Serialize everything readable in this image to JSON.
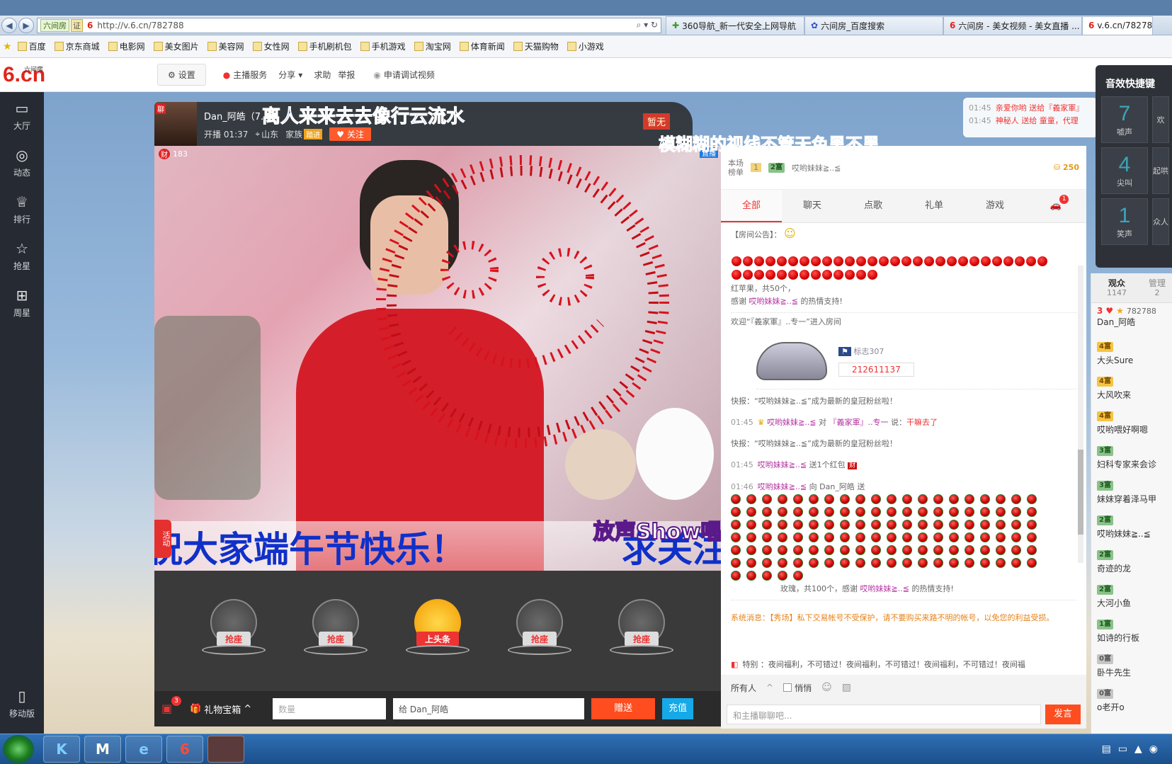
{
  "browser": {
    "url": "http://v.6.cn/782788",
    "addr_tag": "六间房",
    "addr_cert": "证",
    "tabs": [
      "360导航_新一代安全上网导航",
      "六间房_百度搜索",
      "六间房 - 美女视频 - 美女直播 ...",
      "v.6.cn/782788"
    ],
    "bookmarks": [
      "百度",
      "京东商城",
      "电影网",
      "美女图片",
      "美容网",
      "女性网",
      "手机刷机包",
      "手机游戏",
      "淘宝网",
      "体育新闻",
      "天猫购物",
      "小游戏"
    ]
  },
  "site": {
    "logo": "6.cn",
    "logo_sub": "六间房",
    "settings": "设置",
    "header_links": [
      "主播服务",
      "分享",
      "求助",
      "举报"
    ],
    "apply_debug": "申请调试视频",
    "sound_panel_title": "音效快捷键"
  },
  "leftnav": [
    {
      "label": "大厅",
      "icon": "tv-icon"
    },
    {
      "label": "动态",
      "icon": "compass-icon"
    },
    {
      "label": "排行",
      "icon": "crown-icon"
    },
    {
      "label": "抢星",
      "icon": "star-icon"
    },
    {
      "label": "周星",
      "icon": "gift-icon"
    }
  ],
  "leftnav_bottom": "移动版",
  "anchor": {
    "name": "Dan_阿皓（7...",
    "start_time": "开播 01:37",
    "location": "山东",
    "family_label": "家族",
    "family_badge": "踏进",
    "follow": "关注",
    "overlay_title": "离人来来去去像行云流水",
    "overlay_line2": "模糊糊的视线不管天色黑不黑",
    "not_yet": "暂无",
    "live_tag": "直播",
    "wealth": "183",
    "banner": "祝大家端午节快乐！",
    "banner_right": "求关注",
    "activity": "活动",
    "sing_logo": "放声Show唱"
  },
  "seats": [
    {
      "label": "抢座"
    },
    {
      "label": "抢座"
    },
    {
      "label": "上头条"
    },
    {
      "label": "抢座"
    },
    {
      "label": "抢座"
    }
  ],
  "giftbar": {
    "gift_box": "礼物宝箱",
    "qty_placeholder": "数量",
    "to_label": "给 Dan_阿皓",
    "send": "赠送",
    "recharge": "充值",
    "badge": "3"
  },
  "rank": {
    "label1": "本场",
    "label2": "榜单",
    "rank_no": "1",
    "user": "哎哟妹妹≧..≦",
    "level": "2富",
    "score": "250",
    "top_msgs": [
      {
        "time": "01:45",
        "text": "亲爱你哟 送给『義家軍』"
      },
      {
        "time": "01:45",
        "text": "神秘人 送给 童童，代理"
      }
    ]
  },
  "chat_tabs": [
    "全部",
    "聊天",
    "点歌",
    "礼单",
    "游戏"
  ],
  "chat_tab_badge": "1",
  "chat": {
    "notice": "【房间公告】：",
    "apple_gift": "红苹果，共50个，",
    "apple_thanks_pre": "感谢",
    "apple_user": "哎哟妹妹≧..≦",
    "apple_thanks_post": "的热情支持!",
    "welcome": "欢迎“『義家軍』..专一”进入房间",
    "car_name": "标志307",
    "car_id": "212611137",
    "flash1": "快报：“哎哟妹妹≧..≦”成为最新的皇冠粉丝啦！",
    "msg1_time": "01:45",
    "msg1_user": "哎哟妹妹≧..≦",
    "msg1_to": "对",
    "msg1_target": "『義家軍』..专一",
    "msg1_say": "说：",
    "msg1_text": "干嘛去了",
    "flash2": "快报：“哎哟妹妹≧..≦”成为最新的皇冠粉丝啦！",
    "msg2_time": "01:45",
    "msg2_user": "哎哟妹妹≧..≦",
    "msg2_text": "送1个红包",
    "msg3_time": "01:46",
    "msg3_user": "哎哟妹妹≧..≦",
    "msg3_to": "向 Dan_阿皓 送",
    "rose_gift": "玫瑰，共100个，感谢",
    "rose_user": "哎哟妹妹≧..≦",
    "rose_thanks": "的热情支持!",
    "system": "系统消息：【秀场】私下交易帐号不受保护，请不要购买来路不明的帐号，以免您的利益受损。",
    "marquee": "特别 ：夜间福利，不可错过！夜间福利，不可错过！夜间福利，不可错过！夜间福",
    "to_all": "所有人",
    "whisper": "悄悄",
    "input_placeholder": "和主播聊聊吧...",
    "send": "发言"
  },
  "audience": {
    "tab": "观众",
    "count": "1147",
    "tab2": "管理",
    "tab2_count": "2",
    "host_hearts": "3",
    "host_id": "782788",
    "host_name": "Dan_阿皓",
    "list": [
      {
        "lv": "4富",
        "name": "大头Sure",
        "cls": ""
      },
      {
        "lv": "4富",
        "name": "大风吹来",
        "cls": ""
      },
      {
        "lv": "4富",
        "name": "哎哟喂好啊嗯",
        "cls": ""
      },
      {
        "lv": "3富",
        "name": "妇科专家来会诊",
        "cls": "g"
      },
      {
        "lv": "3富",
        "name": "妹妹穿着泽马甲",
        "cls": "g"
      },
      {
        "lv": "2富",
        "name": "哎哟妹妹≧..≦",
        "cls": "g"
      },
      {
        "lv": "2富",
        "name": "奇迹的龙",
        "cls": "g"
      },
      {
        "lv": "2富",
        "name": "大河小鱼",
        "cls": "g"
      },
      {
        "lv": "1富",
        "name": "如诗的行板",
        "cls": "g"
      },
      {
        "lv": "0富",
        "name": "卧牛先生",
        "cls": "s"
      },
      {
        "lv": "0富",
        "name": "o老开o",
        "cls": "s"
      }
    ]
  },
  "sound": [
    {
      "num": "7",
      "label": "嘘声"
    },
    {
      "num": "4",
      "label": "尖叫"
    },
    {
      "num": "1",
      "label": "笑声"
    }
  ],
  "sound_partial": [
    "欢",
    "起哄",
    "众人"
  ]
}
